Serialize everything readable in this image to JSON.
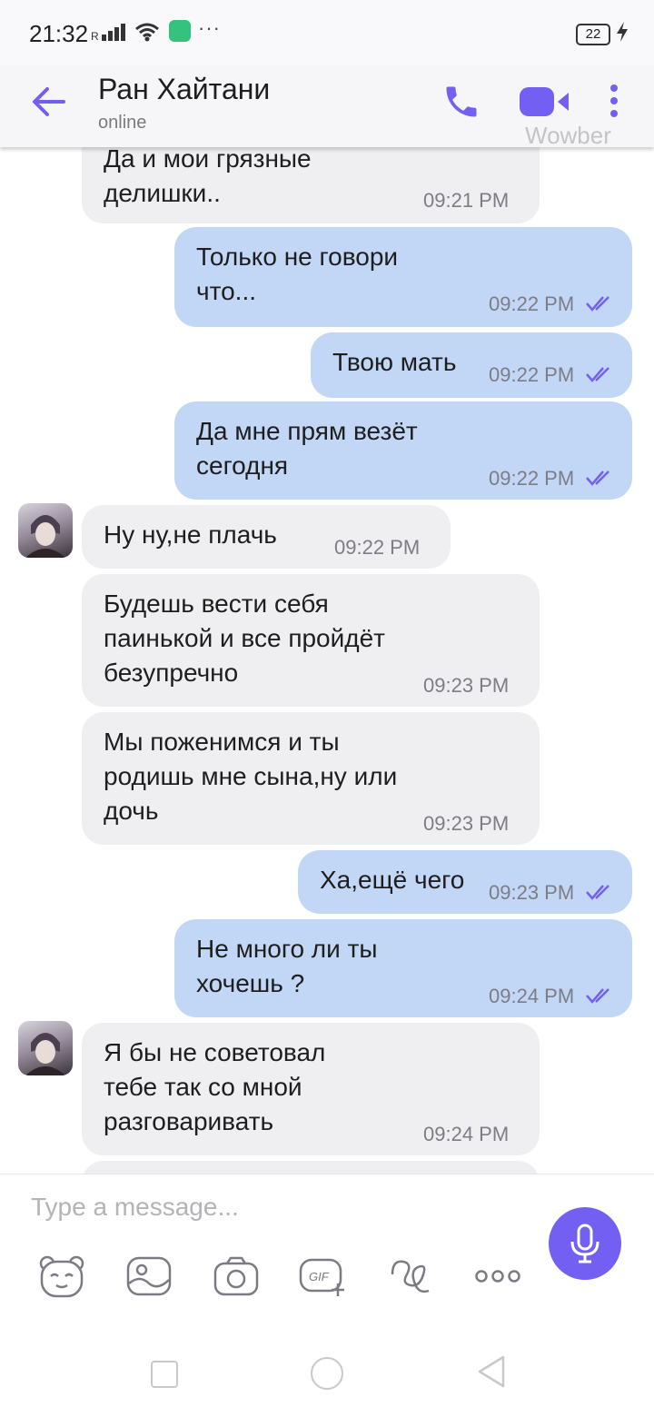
{
  "status_bar": {
    "time": "21:32",
    "battery": "22",
    "more": "···"
  },
  "header": {
    "contact_name": "Ран Хайтани",
    "status": "online",
    "watermark": "Wowber"
  },
  "messages": [
    {
      "dir": "in",
      "text": "Да и мои грязные\nделишки..",
      "time": "09:21 PM"
    },
    {
      "dir": "out",
      "text": "Только не говори\nчто...",
      "time": "09:22 PM"
    },
    {
      "dir": "out",
      "text": "Твою мать",
      "time": "09:22 PM"
    },
    {
      "dir": "out",
      "text": "Да мне прям везёт\nсегодня",
      "time": "09:22 PM"
    },
    {
      "dir": "in",
      "text": "Ну ну,не плачь",
      "time": "09:22 PM",
      "avatar": true
    },
    {
      "dir": "in",
      "text": "Будешь вести себя\nпаинькой и все пройдёт\nбезупречно",
      "time": "09:23 PM"
    },
    {
      "dir": "in",
      "text": "Мы поженимся и ты\nродишь мне сына,ну или\nдочь",
      "time": "09:23 PM"
    },
    {
      "dir": "out",
      "text": "Ха,ещё чего",
      "time": "09:23 PM"
    },
    {
      "dir": "out",
      "text": "Не много ли ты\nхочешь ?",
      "time": "09:24 PM"
    },
    {
      "dir": "in",
      "text": "Я бы не советовал\nтебе так со мной\nразговаривать",
      "time": "09:24 PM",
      "avatar": true
    }
  ],
  "composer": {
    "placeholder": "Type a message...",
    "tools": [
      "sticker-icon",
      "gallery-icon",
      "camera-icon",
      "gif-icon",
      "doodle-icon",
      "more-options-icon"
    ]
  },
  "colors": {
    "accent": "#7360f2",
    "incoming_bubble": "#efeef1",
    "outgoing_bubble": "#c2d7f5",
    "read_ticks": "#7360f2"
  }
}
